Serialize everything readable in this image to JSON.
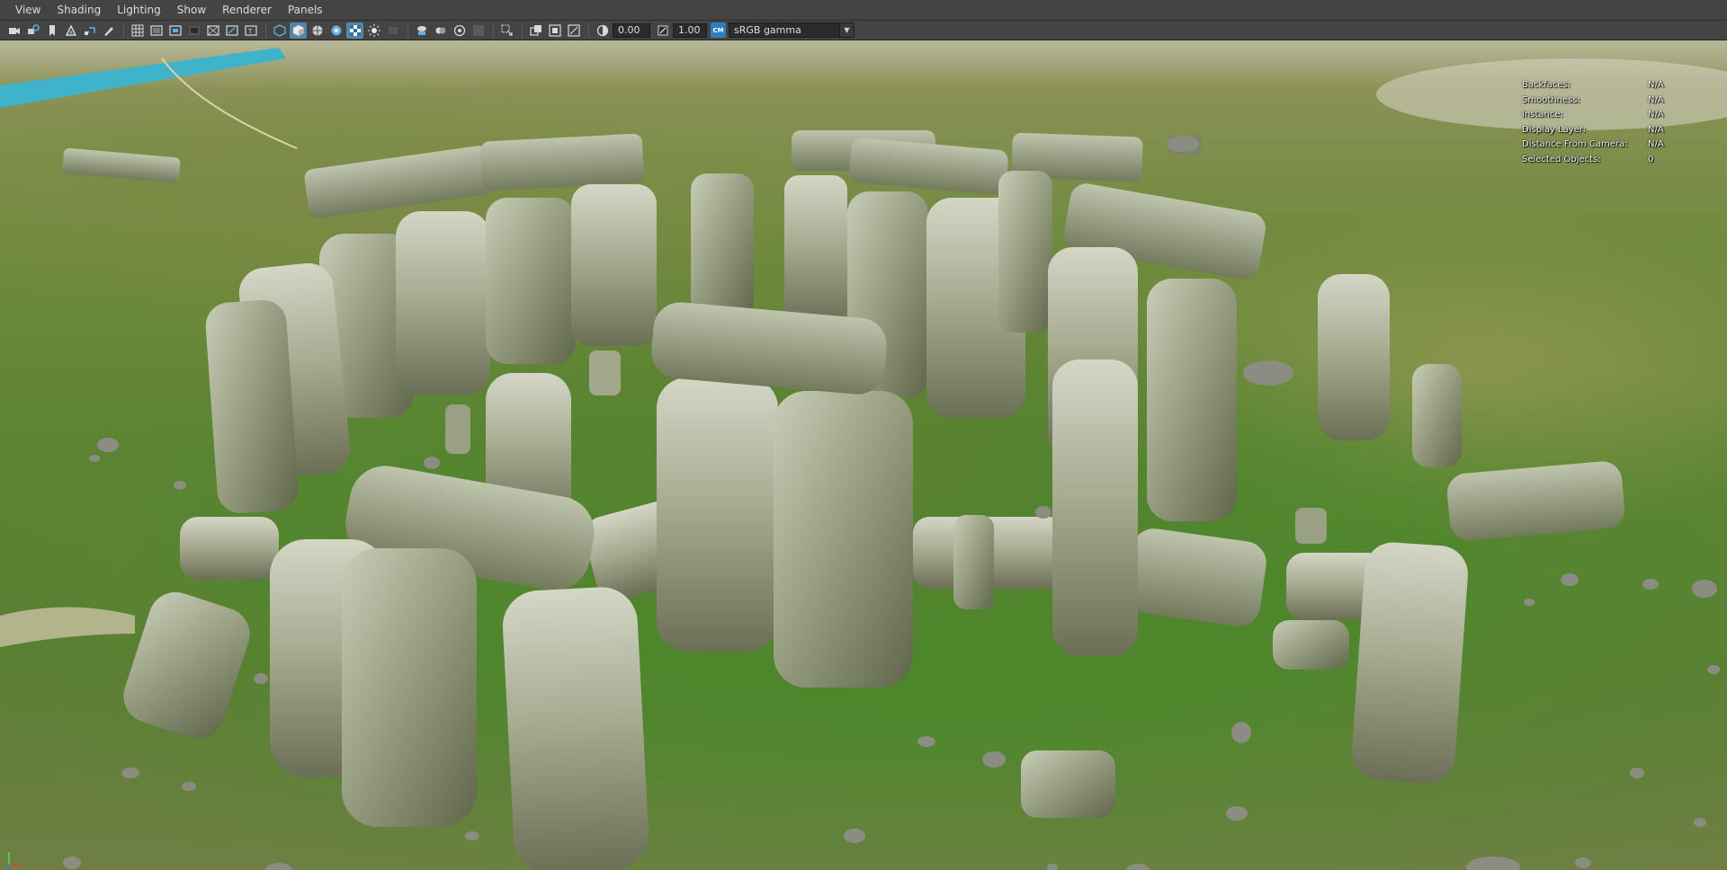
{
  "menubar": {
    "items": [
      "View",
      "Shading",
      "Lighting",
      "Show",
      "Renderer",
      "Panels"
    ]
  },
  "toolbar": {
    "exposure_value": "0.00",
    "gamma_value": "1.00",
    "color_mgmt_badge": "CM",
    "view_transform": "sRGB gamma",
    "icons": [
      "camera-select-icon",
      "camera-attributes-icon",
      "bookmark-icon",
      "image-plane-icon",
      "two-d-pan-zoom-icon",
      "grease-pencil-icon",
      "grid-icon",
      "film-gate-icon",
      "resolution-gate-icon",
      "gate-mask-icon",
      "field-chart-icon",
      "safe-action-icon",
      "safe-title-icon",
      "wireframe-icon",
      "smooth-shade-icon",
      "wireframe-on-shaded-icon",
      "textured-icon",
      "use-all-lights-icon",
      "shadows-icon",
      "screen-space-ao-icon",
      "motion-blur-icon",
      "multisample-aa-icon",
      "depth-of-field-icon",
      "xray-icon",
      "isolate-select-icon",
      "xray-joints-icon",
      "xray-active-icon",
      "backface-cull-icon"
    ]
  },
  "hud": {
    "rows": [
      {
        "label": "Backfaces:",
        "value": "N/A"
      },
      {
        "label": "Smoothness:",
        "value": "N/A"
      },
      {
        "label": "Instance:",
        "value": "N/A"
      },
      {
        "label": "Display Layer:",
        "value": "N/A"
      },
      {
        "label": "Distance From Camera:",
        "value": "N/A"
      },
      {
        "label": "Selected Objects:",
        "value": "0"
      }
    ]
  },
  "colors": {
    "chrome_bg": "#444444",
    "accent": "#5285a6",
    "grass": "#5b8432",
    "stone": "#9ea58a"
  }
}
